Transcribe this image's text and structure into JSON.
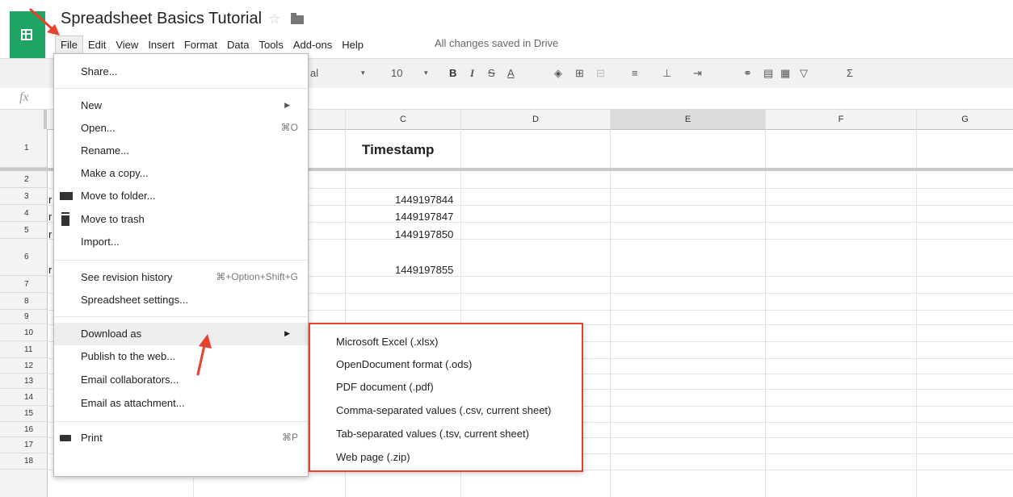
{
  "app": {
    "title": "Spreadsheet Basics Tutorial",
    "star_icon": "☆",
    "saved_status": "All changes saved in Drive"
  },
  "menubar": [
    "File",
    "Edit",
    "View",
    "Insert",
    "Format",
    "Data",
    "Tools",
    "Add-ons",
    "Help"
  ],
  "toolbar": {
    "font_fragment": "al",
    "font_size": "10",
    "bold": "B",
    "italic": "I",
    "strike": "S",
    "text_color": "A",
    "sigma": "Σ"
  },
  "formula_bar": {
    "fx": "fx"
  },
  "columns": [
    "C",
    "D",
    "E",
    "F",
    "G"
  ],
  "rows": [
    "1",
    "2",
    "3",
    "4",
    "5",
    "6",
    "7",
    "8",
    "9",
    "10",
    "11",
    "12",
    "13",
    "14",
    "15",
    "16",
    "17",
    "18"
  ],
  "cells": {
    "c1": "Timestamp",
    "c3": "1449197844",
    "c4": "1449197847",
    "c5": "1449197850",
    "c6": "1449197855",
    "a_partial": "r"
  },
  "file_menu": {
    "share": "Share...",
    "new": "New",
    "open": "Open...",
    "open_shortcut": "⌘O",
    "rename": "Rename...",
    "make_copy": "Make a copy...",
    "move_folder": "Move to folder...",
    "move_trash": "Move to trash",
    "import": "Import...",
    "revision": "See revision history",
    "revision_shortcut": "⌘+Option+Shift+G",
    "settings": "Spreadsheet settings...",
    "download": "Download as",
    "publish": "Publish to the web...",
    "email_collab": "Email collaborators...",
    "email_attach": "Email as attachment...",
    "print": "Print",
    "print_shortcut": "⌘P"
  },
  "download_submenu": [
    "Microsoft Excel (.xlsx)",
    "OpenDocument format (.ods)",
    "PDF document (.pdf)",
    "Comma-separated values (.csv, current sheet)",
    "Tab-separated values (.tsv, current sheet)",
    "Web page (.zip)"
  ],
  "colors": {
    "accent_red": "#e8422f",
    "sheets_green": "#1fa463"
  }
}
